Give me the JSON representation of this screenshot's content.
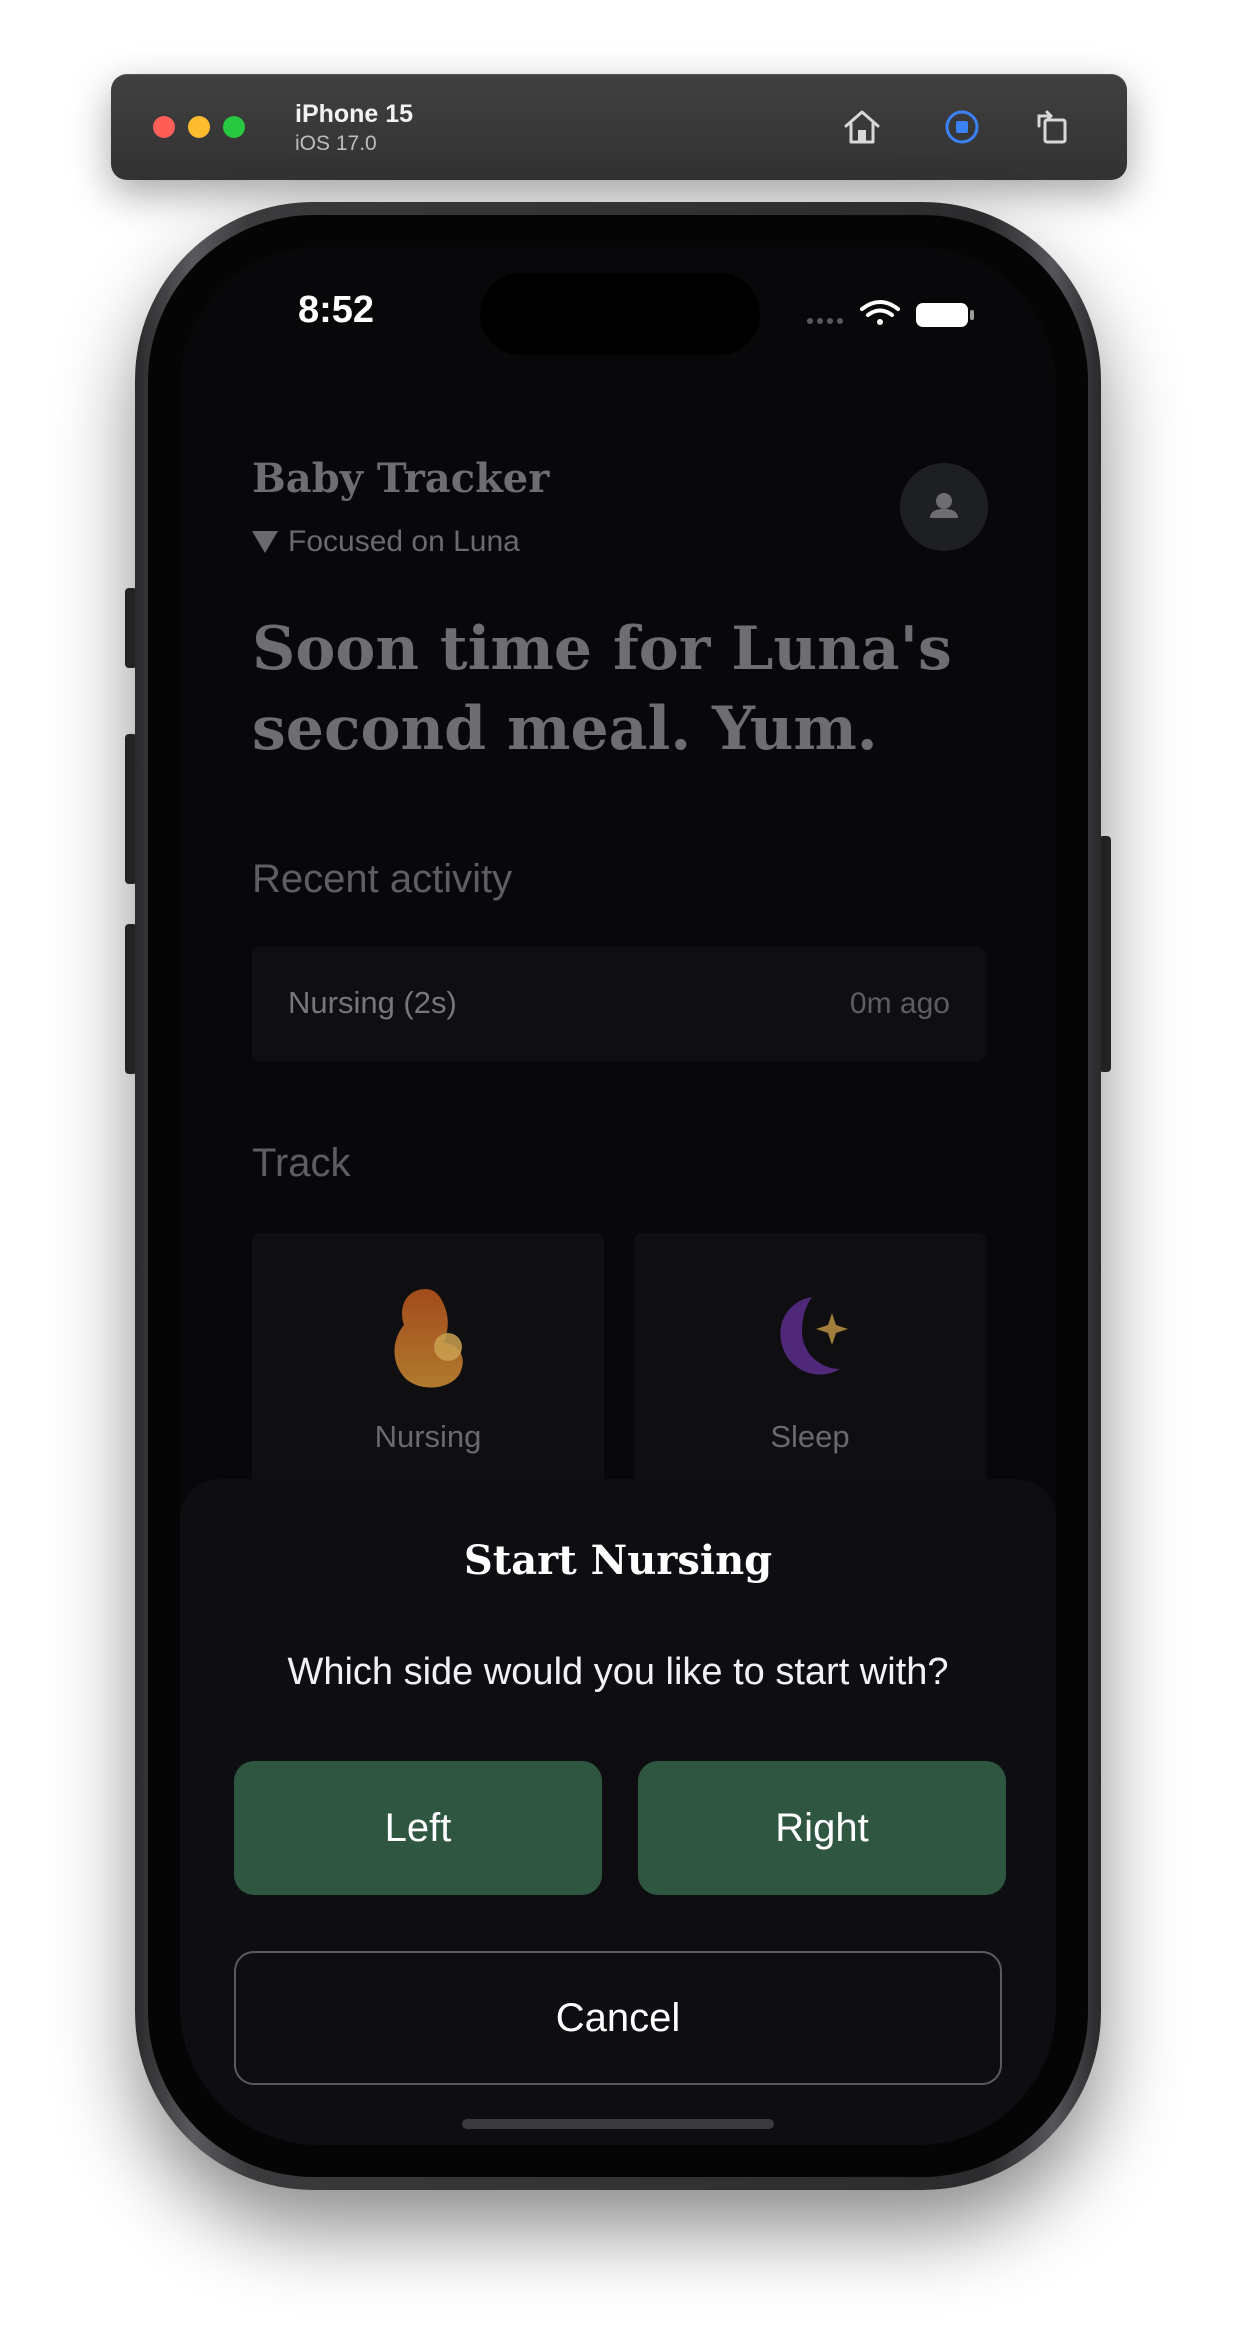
{
  "simulator": {
    "device_name": "iPhone 15",
    "os_version": "iOS 17.0",
    "icons": [
      "home-icon",
      "record-icon",
      "rotate-icon"
    ]
  },
  "status_bar": {
    "time": "8:52",
    "icons": [
      "signal-dots-icon",
      "wifi-icon",
      "battery-icon"
    ]
  },
  "app": {
    "title": "Baby Tracker",
    "focus_label": "Focused on Luna",
    "headline": "Soon time for Luna's second meal. Yum.",
    "recent_activity": {
      "heading": "Recent activity",
      "items": [
        {
          "name": "Nursing (2s)",
          "time": "0m ago"
        }
      ]
    },
    "track": {
      "heading": "Track",
      "items": [
        {
          "label": "Nursing",
          "icon": "nursing-icon"
        },
        {
          "label": "Sleep",
          "icon": "moon-star-icon"
        }
      ]
    }
  },
  "sheet": {
    "title": "Start Nursing",
    "question": "Which side would you like to start with?",
    "left_label": "Left",
    "right_label": "Right",
    "cancel_label": "Cancel"
  },
  "colors": {
    "sheet_bg": "#0e0d12",
    "button_green": "#2f5640",
    "dimmed_text": "#6e6e72"
  }
}
